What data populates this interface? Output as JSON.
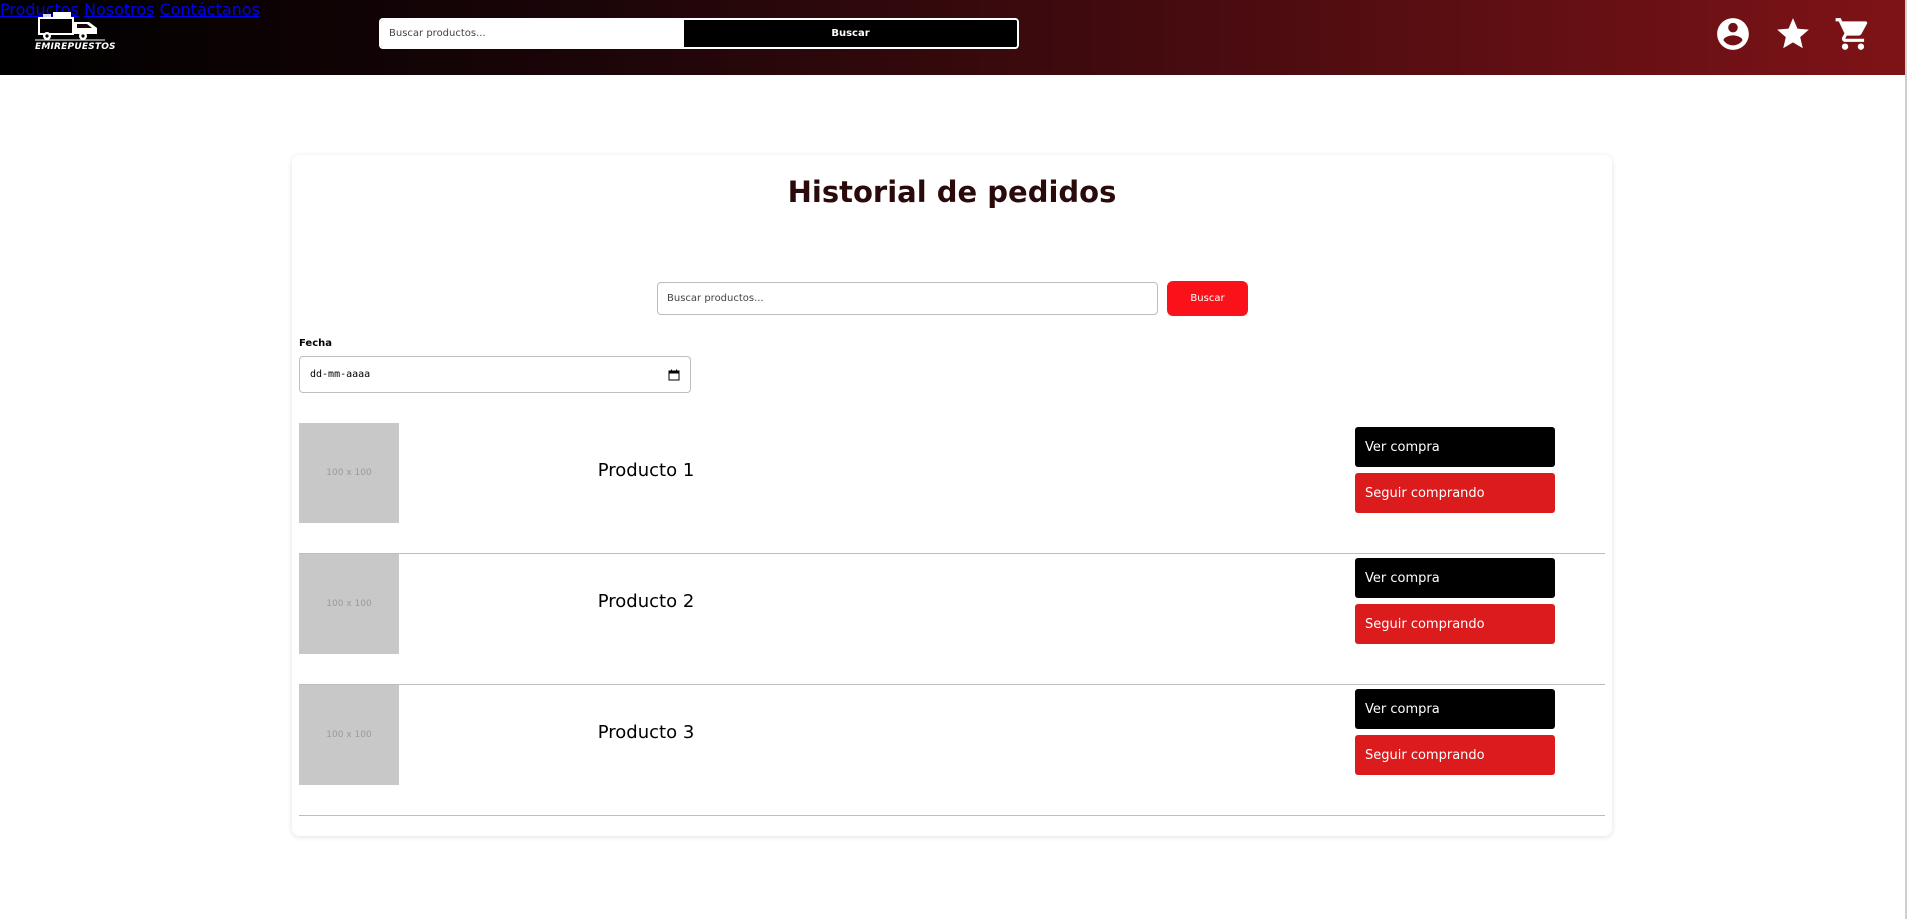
{
  "header": {
    "logo_text": "EMIREPUESTOS",
    "search": {
      "placeholder": "Buscar productos...",
      "button_label": "Buscar"
    },
    "nav": [
      "Productos",
      "Nosotros",
      "Contáctanos"
    ],
    "icons": [
      "account-icon",
      "star-icon",
      "cart-icon"
    ]
  },
  "page": {
    "title": "Historial de pedidos",
    "search": {
      "placeholder": "Buscar productos...",
      "button_label": "Buscar"
    },
    "date_filter": {
      "label": "Fecha",
      "value": "dd-mm-aaaa"
    },
    "orders": [
      {
        "image_placeholder": "100 x 100",
        "product": "Producto 1",
        "view_label": "Ver compra",
        "continue_label": "Seguir comprando"
      },
      {
        "image_placeholder": "100 x 100",
        "product": "Producto 2",
        "view_label": "Ver compra",
        "continue_label": "Seguir comprando"
      },
      {
        "image_placeholder": "100 x 100",
        "product": "Producto 3",
        "view_label": "Ver compra",
        "continue_label": "Seguir comprando"
      }
    ]
  },
  "colors": {
    "header_start": "#000000",
    "header_end": "#7e1317",
    "search_button": "#fb1119",
    "continue_button": "#dc1b1d",
    "view_button": "#000000",
    "title": "#2a0a0a"
  }
}
